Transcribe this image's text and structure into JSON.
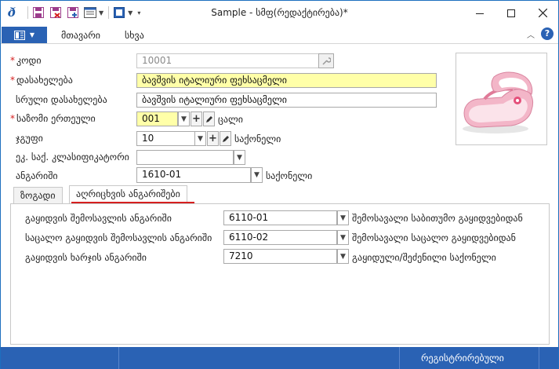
{
  "window": {
    "title": "Sample - სმფ(რედაქტირება)*",
    "app_icon": "ð"
  },
  "menu": {
    "file_icon": "ribbon-menu-icon",
    "items": [
      "მთავარი",
      "სხვა"
    ],
    "help": "?"
  },
  "form": {
    "code": {
      "label": "კოდი",
      "required": "*",
      "value": "10001"
    },
    "name": {
      "label": "დასახელება",
      "required": "*",
      "value": "ბავშვის იტალიური ფეხსაცმელი"
    },
    "full_name": {
      "label": "სრული დასახელება",
      "value": "ბავშვის იტალიური ფეხსაცმელი"
    },
    "unit": {
      "label": "საზომი ერთეული",
      "required": "*",
      "value": "001",
      "suffix": "ცალი"
    },
    "group": {
      "label": "ჯგუფი",
      "value": "10",
      "suffix": "საქონელი"
    },
    "classifier": {
      "label": "ეკ. საქ. კლასიფიკატორი",
      "value": ""
    },
    "account": {
      "label": "ანგარიში",
      "value": "1610-01",
      "suffix": "საქონელი"
    }
  },
  "tabs": [
    "ზოგადი",
    "აღრიცხვის ანგარიშები"
  ],
  "accounts": [
    {
      "label": "გაყიდვის შემოსავლის ანგარიში",
      "value": "6110-01",
      "suffix": "შემოსავალი საბითუმო გაყიდვებიდან"
    },
    {
      "label": "საცალო გაყიდვის შემოსავლის ანგარიში",
      "value": "6110-02",
      "suffix": "შემოსავალი საცალო გაყიდვებიდან"
    },
    {
      "label": "გაყიდვის ხარჯის ანგარიში",
      "value": "7210",
      "suffix": "გაყიდული/შეძენილი საქონელი"
    }
  ],
  "status": {
    "text": "რეგისტრირებული"
  },
  "colors": {
    "accent": "#2a62b4",
    "required": "#d62020",
    "highlight": "#ffffa8"
  }
}
